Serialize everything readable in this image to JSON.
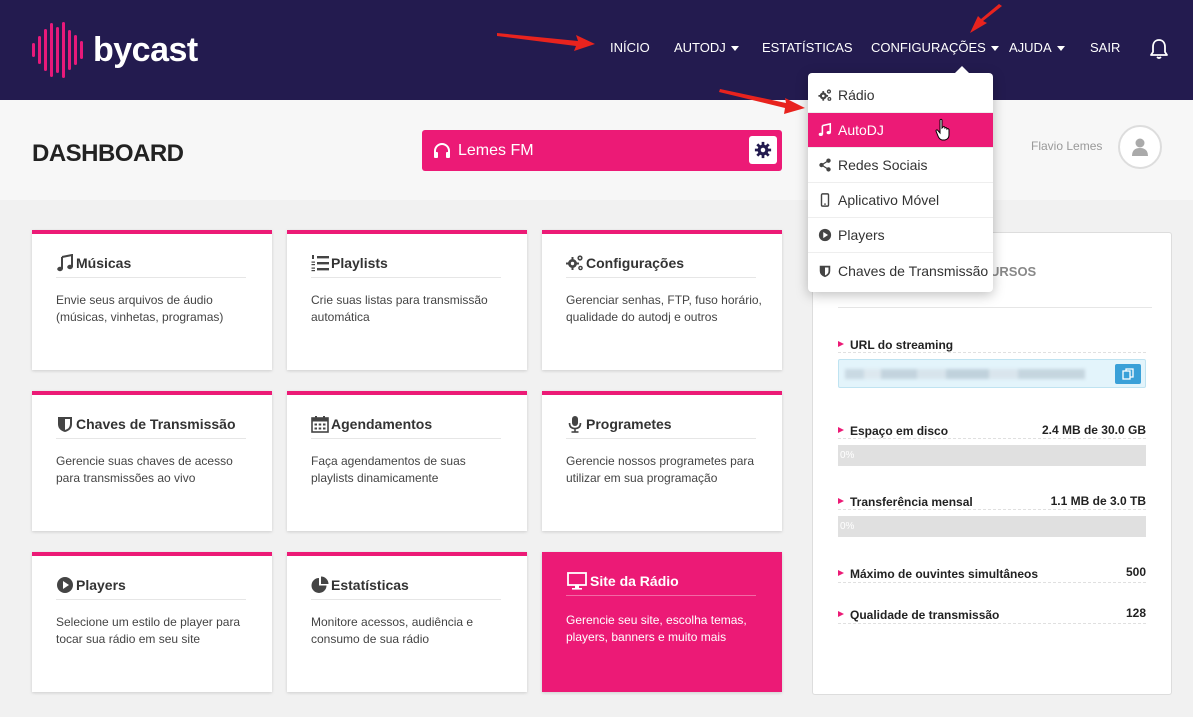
{
  "brand": {
    "name": "bycast",
    "accent": "#ec1a76",
    "nav_bg": "#231b4f"
  },
  "nav": {
    "items": [
      {
        "label": "INÍCIO",
        "has_caret": false
      },
      {
        "label": "AUTODJ",
        "has_caret": true
      },
      {
        "label": "ESTATÍSTICAS",
        "has_caret": false
      },
      {
        "label": "CONFIGURAÇÕES",
        "has_caret": true
      },
      {
        "label": "AJUDA",
        "has_caret": true
      },
      {
        "label": "SAIR",
        "has_caret": false
      }
    ],
    "notification_icon": "bell-icon"
  },
  "header": {
    "title": "DASHBOARD",
    "radio_name": "Lemes FM",
    "user_name": "Flavio Lemes"
  },
  "dropdown": {
    "items": [
      {
        "label": "Rádio",
        "icon": "gears-icon",
        "active": false
      },
      {
        "label": "AutoDJ",
        "icon": "music-icon",
        "active": true
      },
      {
        "label": "Redes Sociais",
        "icon": "share-icon",
        "active": false
      },
      {
        "label": "Aplicativo Móvel",
        "icon": "mobile-icon",
        "active": false
      },
      {
        "label": "Players",
        "icon": "play-circle-icon",
        "active": false
      },
      {
        "label": "Chaves de Transmissão",
        "icon": "shield-icon",
        "active": false
      }
    ]
  },
  "cards": [
    {
      "title": "Músicas",
      "icon": "music-icon",
      "desc": "Envie seus arquivos de áudio (músicas, vinhetas, programas)"
    },
    {
      "title": "Playlists",
      "icon": "list-ol-icon",
      "desc": "Crie suas listas para transmissão automática"
    },
    {
      "title": "Configurações",
      "icon": "gears-icon",
      "desc": "Gerenciar senhas, FTP, fuso horário, qualidade do autodj e outros"
    },
    {
      "title": "Chaves de Transmissão",
      "icon": "shield-icon",
      "desc": "Gerencie suas chaves de acesso para transmissões ao vivo"
    },
    {
      "title": "Agendamentos",
      "icon": "calendar-icon",
      "desc": "Faça agendamentos de suas playlists dinamicamente"
    },
    {
      "title": "Programetes",
      "icon": "microphone-icon",
      "desc": "Gerencie nossos programetes para utilizar em sua programação"
    },
    {
      "title": "Players",
      "icon": "play-circle-icon",
      "desc": "Selecione um estilo de player para tocar sua rádio em seu site"
    },
    {
      "title": "Estatísticas",
      "icon": "pie-chart-icon",
      "desc": "Monitore acessos, audiência e consumo de sua rádio"
    },
    {
      "title": "Site da Rádio",
      "icon": "monitor-icon",
      "desc": "Gerencie seu site, escolha temas, players, banners e muito mais"
    }
  ],
  "resources": {
    "title_visible": "URSOS",
    "url_label": "URL do streaming",
    "disk_label": "Espaço em disco",
    "disk_value": "2.4 MB de 30.0 GB",
    "disk_percent_text": "0%",
    "disk_fraction": 0.0,
    "transfer_label": "Transferência mensal",
    "transfer_value": "1.1 MB de 3.0 TB",
    "transfer_percent_text": "0%",
    "transfer_fraction": 0.0,
    "listeners_label": "Máximo de ouvintes simultâneos",
    "listeners_value": "500",
    "quality_label": "Qualidade de transmissão",
    "quality_value": "128"
  }
}
